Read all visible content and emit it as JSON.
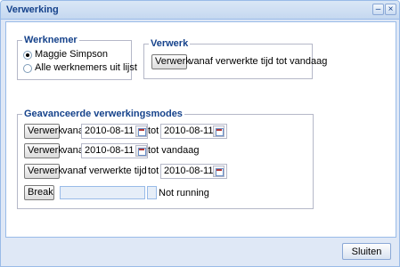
{
  "window": {
    "title": "Verwerking"
  },
  "werknemer": {
    "legend": "Werknemer",
    "options": [
      "Maggie Simpson",
      "Alle werknemers uit lijst"
    ],
    "selected": "Maggie Simpson"
  },
  "verwerk": {
    "legend": "Verwerk",
    "button_label": "Verwerk",
    "label": "vanaf verwerkte tijd tot vandaag"
  },
  "advanced": {
    "legend": "Geavanceerde verwerkingsmodes",
    "row1": {
      "button": "Verwerk",
      "vanaf": "vanaf",
      "from_date": "2010-08-11",
      "tot": "tot",
      "to_date": "2010-08-11"
    },
    "row2": {
      "button": "Verwerk",
      "vanaf": "vanaf",
      "from_date": "2010-08-11",
      "tot_label": "tot vandaag"
    },
    "row3": {
      "button": "Verwerk",
      "label": "vanaf verwerkte tijd",
      "tot": "tot",
      "to_date": "2010-08-11"
    },
    "row4": {
      "button": "Break",
      "status": "Not running"
    }
  },
  "footer": {
    "close_label": "Sluiten"
  }
}
